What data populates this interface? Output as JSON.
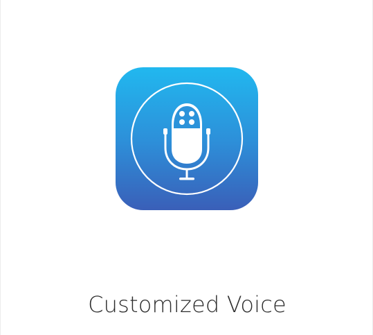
{
  "app": {
    "name": "Customized Voice",
    "icon": "microphone-icon"
  },
  "colors": {
    "icon_gradient_top": "#21b8ef",
    "icon_gradient_bottom": "#3a5fb8",
    "glyph": "#ffffff",
    "label_text": "#2b2b2b",
    "background": "#ffffff"
  }
}
